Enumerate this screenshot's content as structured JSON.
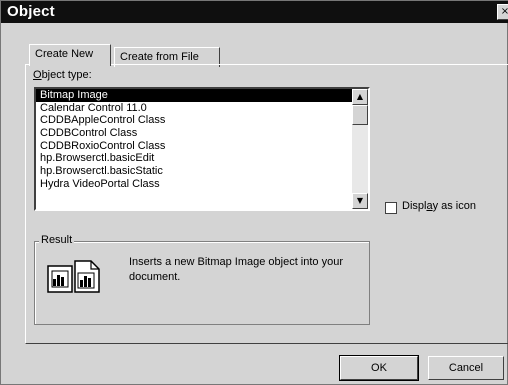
{
  "dialog": {
    "title": "Object",
    "close_glyph": "×"
  },
  "tabs": [
    {
      "label": "Create New",
      "active": true
    },
    {
      "label": "Create from File",
      "active": false
    }
  ],
  "object_type": {
    "label_prefix": "",
    "label_accel": "O",
    "label_rest": "bject type:",
    "items": [
      "Bitmap Image",
      "Calendar Control 11.0",
      "CDDBAppleControl Class",
      "CDDBControl Class",
      "CDDBRoxioControl Class",
      "hp.Browserctl.basicEdit",
      "hp.Browserctl.basicStatic",
      "Hydra VideoPortal Class"
    ],
    "selected_index": 0
  },
  "display_as_icon": {
    "label_prefix": "Displ",
    "label_accel": "a",
    "label_rest": "y as icon",
    "checked": false
  },
  "result": {
    "legend": "Result",
    "text": "Inserts a new Bitmap Image object into your document."
  },
  "buttons": {
    "ok": "OK",
    "cancel": "Cancel"
  },
  "icons": {
    "close": "close-icon",
    "scroll_up": "arrow-up-icon",
    "scroll_down": "arrow-down-icon",
    "result": "bitmap-document-icon"
  }
}
